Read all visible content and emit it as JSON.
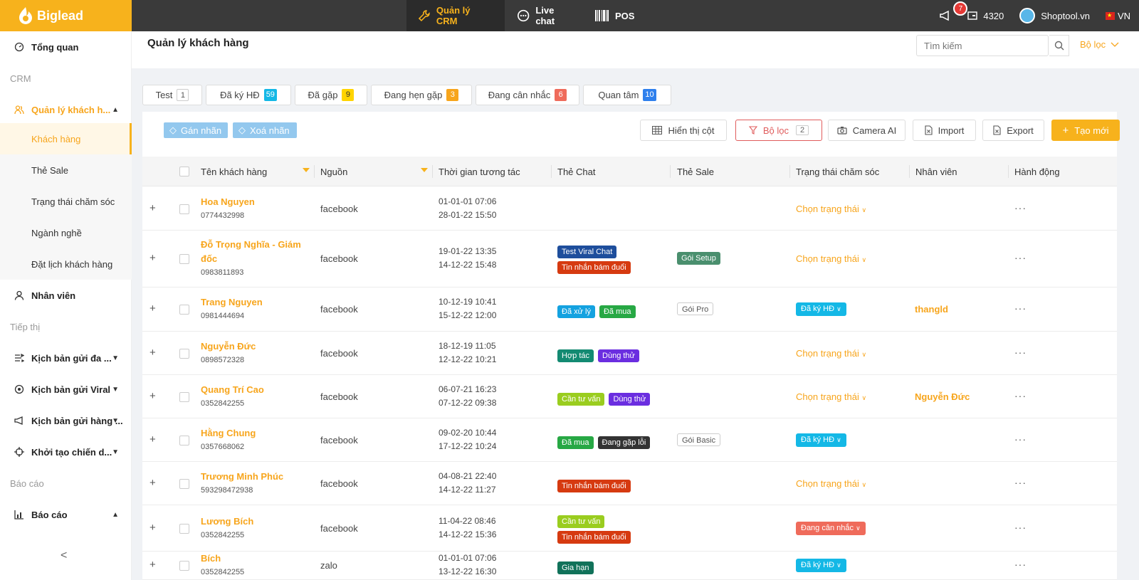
{
  "brand": {
    "name": "Biglead"
  },
  "topnav": {
    "crm": "Quản lý CRM",
    "livechat": "Live chat",
    "pos": "POS",
    "notif_count": "7",
    "credits": "4320",
    "account": "Shoptool.vn",
    "lang": "VN"
  },
  "sidebar": {
    "overview": "Tổng quan",
    "crm_section": "CRM",
    "customer_mgmt": "Quản lý khách h...",
    "sub": [
      "Khách hàng",
      "Thẻ Sale",
      "Trạng thái chăm sóc",
      "Ngành nghề",
      "Đặt lịch khách hàng"
    ],
    "staff": "Nhân viên",
    "marketing_section": "Tiếp thị",
    "script_multi": "Kịch bản gửi đa ...",
    "script_viral": "Kịch bản gửi Viral",
    "script_bulk": "Kịch bản gửi hàng ...",
    "campaign": "Khởi tạo chiến d...",
    "report_section": "Báo cáo",
    "report": "Báo cáo",
    "collapse": "<"
  },
  "header": {
    "title": "Quản lý khách hàng",
    "search_placeholder": "Tìm kiếm",
    "filter": "Bộ lọc"
  },
  "tabs": [
    {
      "label": "Test",
      "count": "1",
      "color": "#ffffff"
    },
    {
      "label": "Đã ký HĐ",
      "count": "59",
      "color": "#14b8e6"
    },
    {
      "label": "Đã gặp",
      "count": "9",
      "color": "#ffd400"
    },
    {
      "label": "Đang hẹn gặp",
      "count": "3",
      "color": "#f7a51c"
    },
    {
      "label": "Đang cân nhắc",
      "count": "6",
      "color": "#ef6b5b"
    },
    {
      "label": "Quan tâm",
      "count": "10",
      "color": "#2f80ed"
    }
  ],
  "toolbar": {
    "add_label": "Gán nhãn",
    "remove_label": "Xoá nhãn",
    "columns": "Hiển thị cột",
    "filter": "Bộ lọc",
    "filter_count": "2",
    "camera": "Camera AI",
    "import": "Import",
    "export": "Export",
    "create": "Tạo mới"
  },
  "columns": [
    "Tên khách hàng",
    "Nguồn",
    "Thời gian tương tác",
    "Thẻ Chat",
    "Thẻ Sale",
    "Trạng thái chăm sóc",
    "Nhân viên",
    "Hành động"
  ],
  "rows": [
    {
      "name": "Hoa Nguyen",
      "phone": "0774432998",
      "source": "facebook",
      "t1": "01-01-01 07:06",
      "t2": "28-01-22 15:50",
      "chat": [],
      "sale": "",
      "status": "Chọn trạng thái",
      "staff": "",
      "action": "···"
    },
    {
      "name": "Đỗ Trọng Nghĩa - Giám đốc",
      "phone": "0983811893",
      "source": "facebook",
      "t1": "19-01-22 13:35",
      "t2": "14-12-22 15:48",
      "chat": [
        {
          "label": "Test Viral Chat",
          "color": "#1e4e9c"
        },
        {
          "label": "Tin nhắn bám đuổi",
          "color": "#d63a10"
        }
      ],
      "sale": "Gói Setup",
      "status": "Chọn trạng thái",
      "staff": "",
      "action": "···"
    },
    {
      "name": "Trang Nguyen",
      "phone": "0981444694",
      "source": "facebook",
      "t1": "10-12-19 10:41",
      "t2": "15-12-22 12:00",
      "chat": [
        {
          "label": "Đã xử lý",
          "color": "#14a2e0"
        },
        {
          "label": "Đã mua",
          "color": "#27a844"
        }
      ],
      "sale": "Gói Pro",
      "status": "Đã ký HĐ",
      "staff": "thangld",
      "action": "···"
    },
    {
      "name": "Nguyễn Đức",
      "phone": "0898572328",
      "source": "facebook",
      "t1": "18-12-19 11:05",
      "t2": "12-12-22 10:21",
      "chat": [
        {
          "label": "Hợp tác",
          "color": "#138a72"
        },
        {
          "label": "Dùng thử",
          "color": "#6b2ee0"
        }
      ],
      "sale": "",
      "status": "Chọn trạng thái",
      "staff": "",
      "action": "···"
    },
    {
      "name": "Quang Trí Cao",
      "phone": "0352842255",
      "source": "facebook",
      "t1": "06-07-21 16:23",
      "t2": "07-12-22 09:38",
      "chat": [
        {
          "label": "Cần tư vấn",
          "color": "#9acd1f"
        },
        {
          "label": "Dùng thử",
          "color": "#6b2ee0"
        }
      ],
      "sale": "",
      "status": "Chọn trạng thái",
      "staff": "Nguyễn Đức",
      "action": "···"
    },
    {
      "name": "Hằng Chung",
      "phone": "0357668062",
      "source": "facebook",
      "t1": "09-02-20 10:44",
      "t2": "17-12-22 10:24",
      "chat": [
        {
          "label": "Đã mua",
          "color": "#27a844"
        },
        {
          "label": "Đang gặp lỗi",
          "color": "#333333"
        }
      ],
      "sale": "Gói Basic",
      "status": "Đã ký HĐ",
      "staff": "",
      "action": "···"
    },
    {
      "name": "Trương Minh Phúc",
      "phone": "593298472938",
      "source": "facebook",
      "t1": "04-08-21 22:40",
      "t2": "14-12-22 11:27",
      "chat": [
        {
          "label": "Tin nhắn bám đuổi",
          "color": "#d63a10"
        }
      ],
      "sale": "",
      "status": "Chọn trạng thái",
      "staff": "",
      "action": "···"
    },
    {
      "name": "Lương Bích",
      "phone": "0352842255",
      "source": "facebook",
      "t1": "11-04-22 08:46",
      "t2": "14-12-22 15:36",
      "chat": [
        {
          "label": "Cần tư vấn",
          "color": "#9acd1f"
        },
        {
          "label": "Tin nhắn bám đuổi",
          "color": "#d63a10"
        }
      ],
      "sale": "",
      "status": "Đang cân nhắc",
      "staff": "",
      "action": "···"
    },
    {
      "name": "Bích",
      "phone": "0352842255",
      "source": "zalo",
      "t1": "01-01-01 07:06",
      "t2": "13-12-22 16:30",
      "chat": [
        {
          "label": "Gia hạn",
          "color": "#11725a"
        }
      ],
      "sale": "",
      "status": "Đã ký HĐ",
      "staff": "",
      "action": "···"
    }
  ],
  "colors": {
    "accent": "#f7b21c",
    "signed": "#14b8e6",
    "considering": "#ef6b5b",
    "sale_setup": "#4a8f6e"
  }
}
